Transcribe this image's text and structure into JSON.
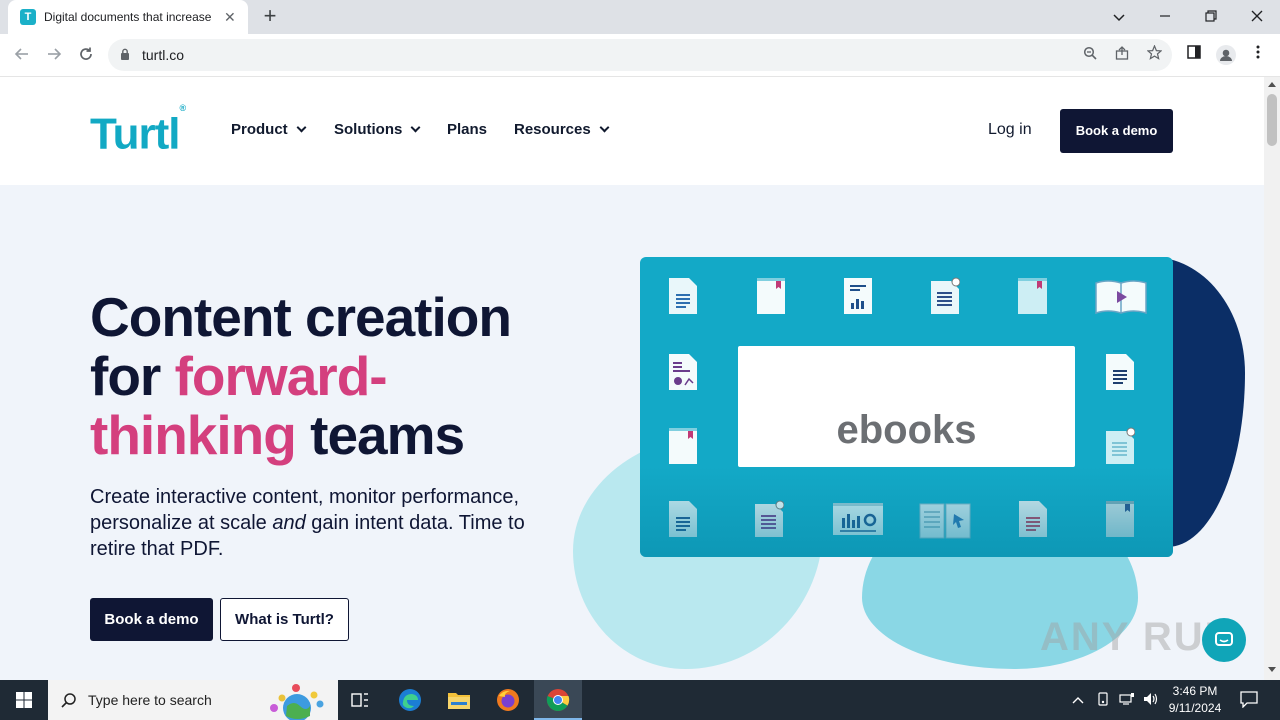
{
  "browser": {
    "tab_title": "Digital documents that increase",
    "tab_favicon_letter": "T",
    "url": "turtl.co"
  },
  "site": {
    "logo": "Turtl",
    "logo_mark": "®",
    "nav": [
      {
        "label": "Product",
        "dropdown": true
      },
      {
        "label": "Solutions",
        "dropdown": true
      },
      {
        "label": "Plans",
        "dropdown": false
      },
      {
        "label": "Resources",
        "dropdown": true
      }
    ],
    "login": "Log in",
    "header_cta": "Book a demo"
  },
  "hero": {
    "title_line1": "Content creation",
    "title_for": "for ",
    "title_accent1": "forward-",
    "title_accent2": "thinking",
    "title_end": " teams",
    "sub_part1": "Create interactive content, monitor performance, personalize at scale ",
    "sub_em": "and",
    "sub_part2": " gain intent data. Time to retire that PDF.",
    "cta_primary": "Book a demo",
    "cta_secondary": "What is Turtl?"
  },
  "illustration": {
    "card_word": "ebooks"
  },
  "watermark": "ANY RUN",
  "taskbar": {
    "search_placeholder": "Type here to search",
    "time": "3:46 PM",
    "date": "9/11/2024"
  },
  "colors": {
    "brand_teal": "#12a9c4",
    "navy": "#0f1634",
    "accent_pink": "#d43f7e",
    "page_bg": "#f0f4fa"
  }
}
